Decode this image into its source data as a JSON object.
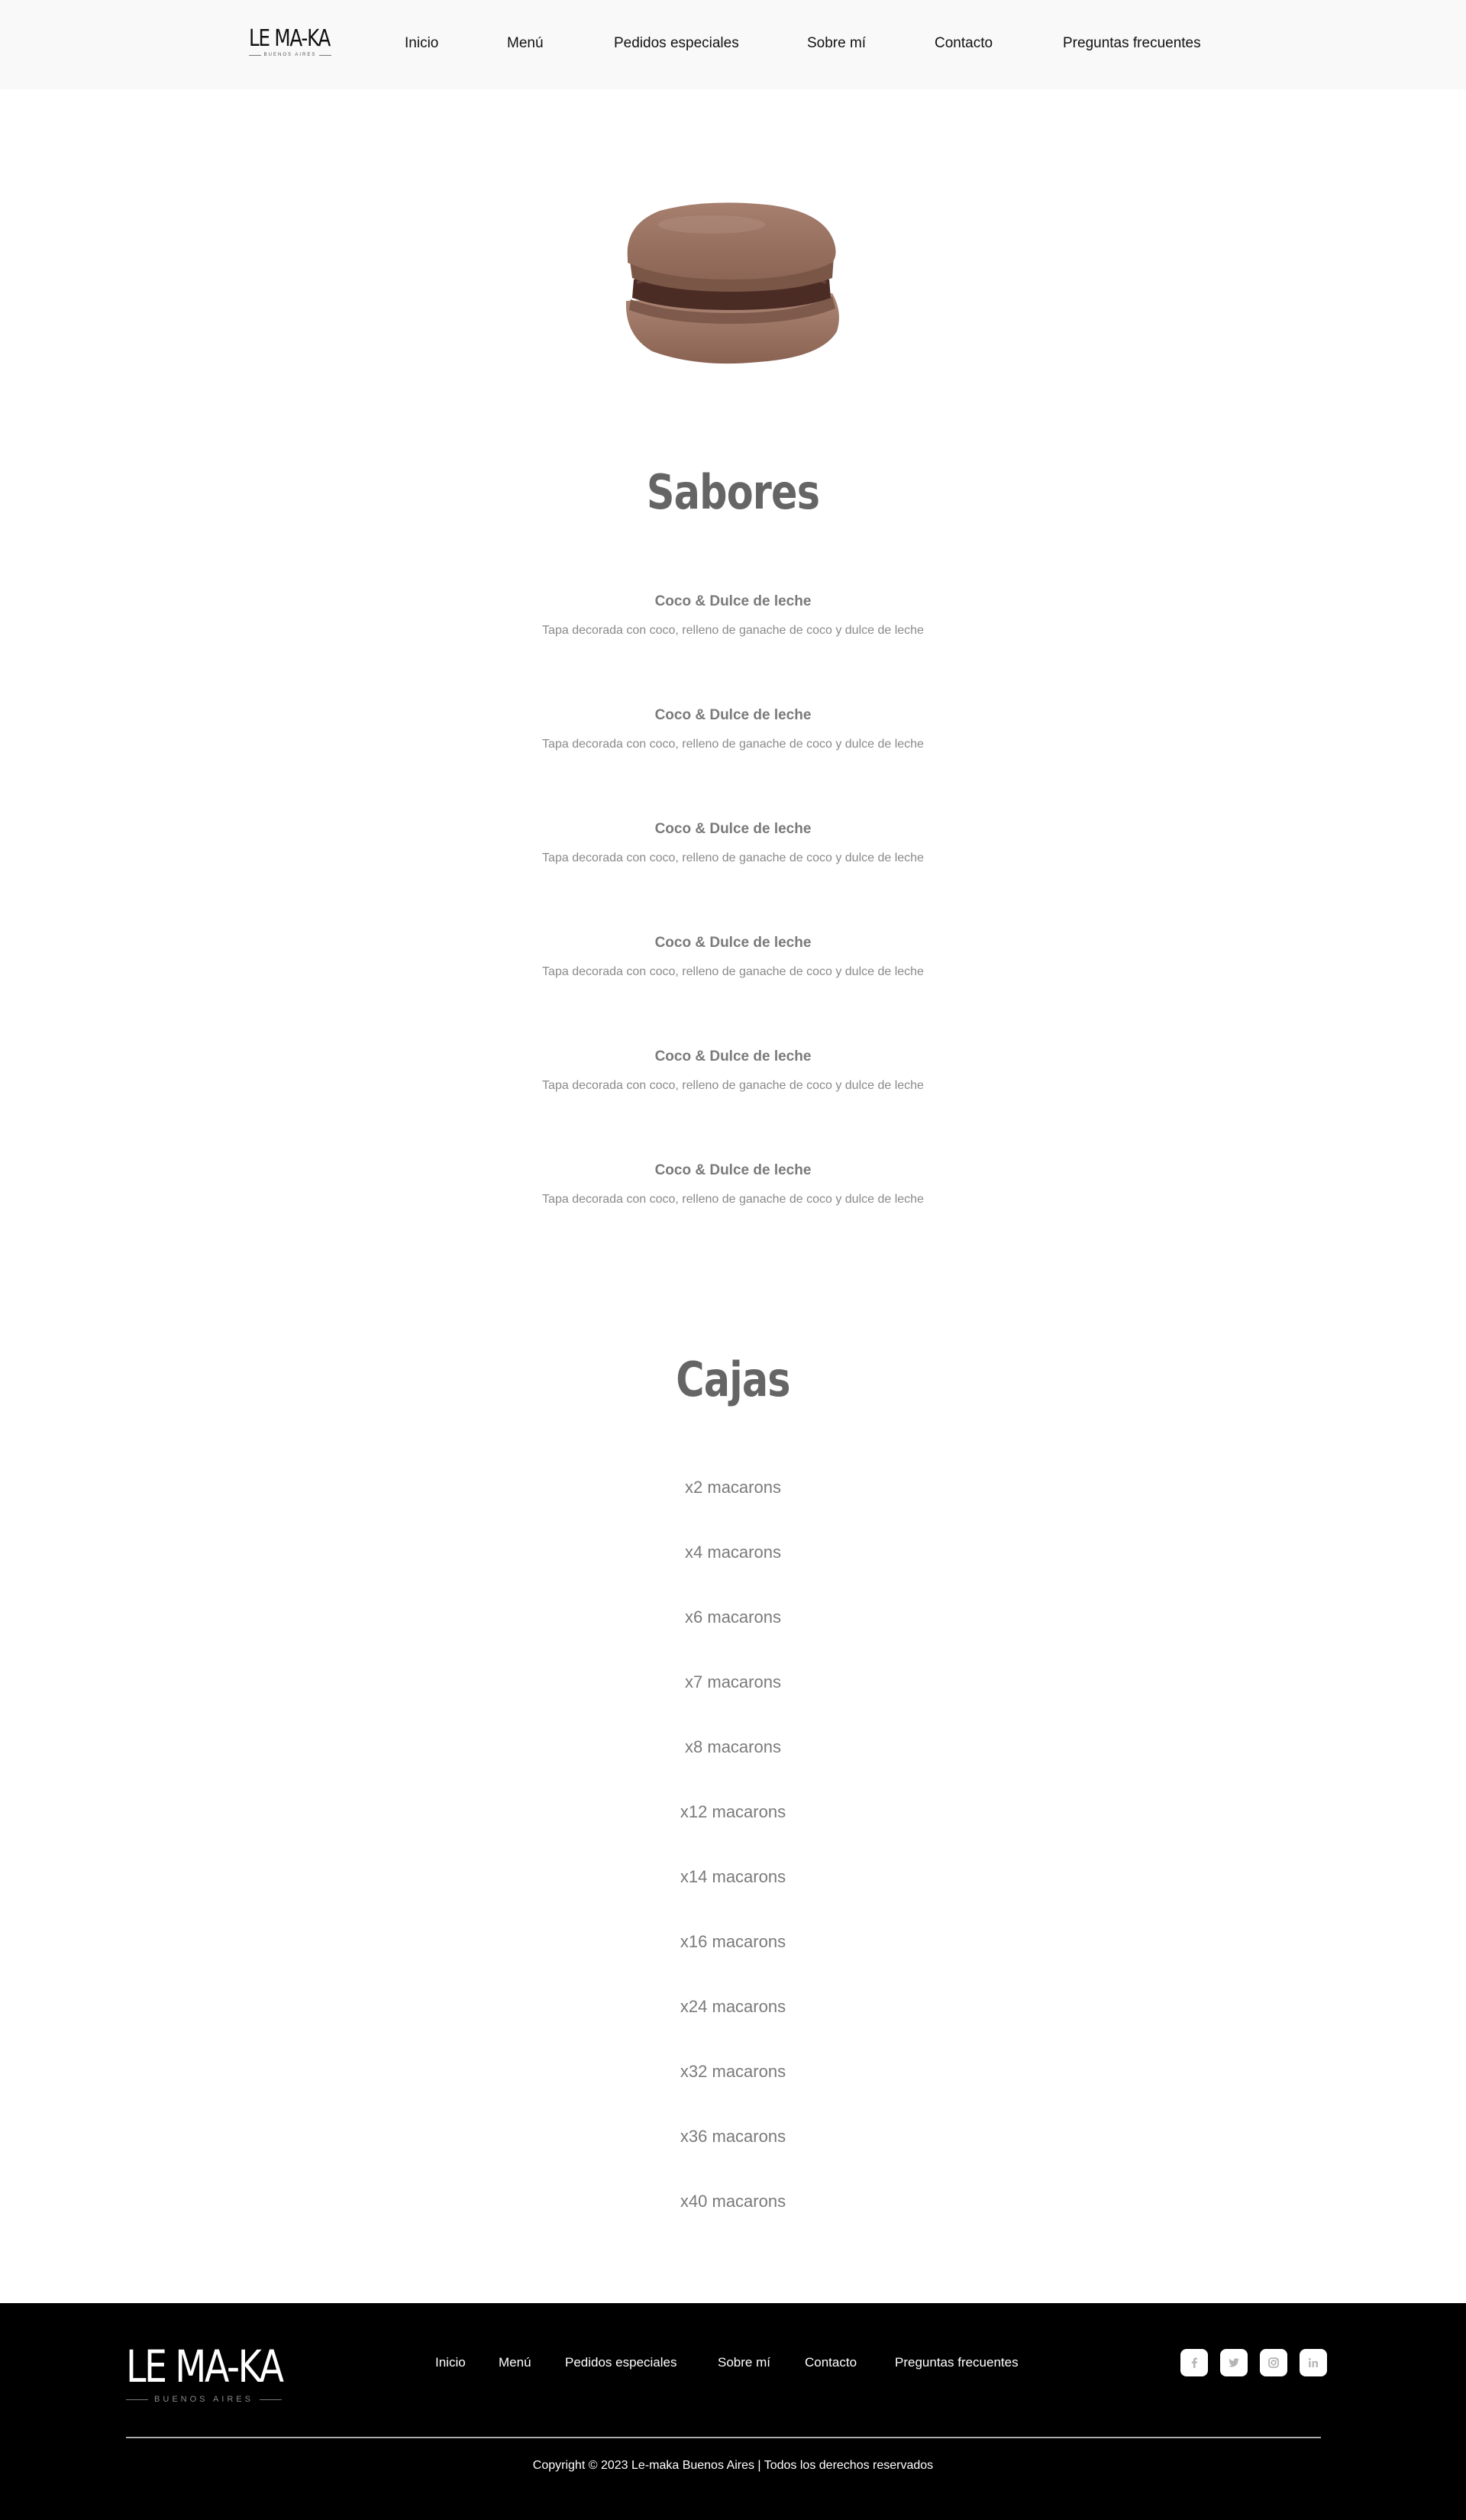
{
  "brand": {
    "name": "LE MA-KA",
    "tagline": "BUENOS AIRES"
  },
  "nav": {
    "items": [
      "Inicio",
      "Menú",
      "Pedidos especiales",
      "Sobre mí",
      "Contacto",
      "Preguntas frecuentes"
    ]
  },
  "sabores": {
    "title": "Sabores",
    "items": [
      {
        "name": "Coco & Dulce de leche",
        "desc": "Tapa decorada con coco, relleno de ganache de coco y dulce de leche"
      },
      {
        "name": "Coco & Dulce de leche",
        "desc": "Tapa decorada con coco, relleno de ganache de coco y dulce de leche"
      },
      {
        "name": "Coco & Dulce de leche",
        "desc": "Tapa decorada con coco, relleno de ganache de coco y dulce de leche"
      },
      {
        "name": "Coco & Dulce de leche",
        "desc": "Tapa decorada con coco, relleno de ganache de coco y dulce de leche"
      },
      {
        "name": "Coco & Dulce de leche",
        "desc": "Tapa decorada con coco, relleno de ganache de coco y dulce de leche"
      },
      {
        "name": "Coco & Dulce de leche",
        "desc": "Tapa decorada con coco, relleno de ganache de coco y dulce de leche"
      }
    ]
  },
  "cajas": {
    "title": "Cajas",
    "items": [
      "x2 macarons",
      "x4 macarons",
      "x6 macarons",
      "x7 macarons",
      "x8 macarons",
      "x12 macarons",
      "x14 macarons",
      "x16 macarons",
      "x24 macarons",
      "x32 macarons",
      "x36 macarons",
      "x40 macarons"
    ]
  },
  "footer": {
    "nav": [
      "Inicio",
      "Menú",
      "Pedidos especiales",
      "Sobre mí",
      "Contacto",
      "Preguntas frecuentes"
    ],
    "social": [
      "facebook-icon",
      "twitter-icon",
      "instagram-icon",
      "linkedin-icon"
    ],
    "copyright": "Copyright © 2023 Le-maka Buenos Aires | Todos los derechos reservados"
  },
  "colors": {
    "header_bg": "#f9f9f9",
    "footer_bg": "#000000",
    "heading": "#656565",
    "text_muted": "#7a7a7a"
  }
}
